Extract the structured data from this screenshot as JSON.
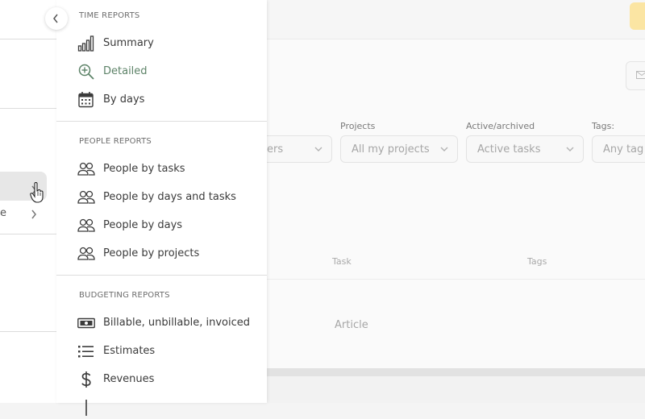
{
  "left_nav": {
    "visible_fragment": "e"
  },
  "filters": {
    "first": {
      "value_fragment": "ers"
    },
    "projects": {
      "label": "Projects",
      "value": "All my projects"
    },
    "active_archived": {
      "label": "Active/archived",
      "value": "Active tasks"
    },
    "tags": {
      "label": "Tags:",
      "placeholder": "Any tag"
    }
  },
  "table": {
    "headers": {
      "task": "Task",
      "tags": "Tags"
    },
    "rows": [
      {
        "task": "Article"
      }
    ]
  },
  "reports_menu": {
    "sections": [
      {
        "title": "TIME REPORTS",
        "items": [
          {
            "label": "Summary",
            "icon": "bar-chart-icon"
          },
          {
            "label": "Detailed",
            "icon": "zoom-in-icon"
          },
          {
            "label": "By days",
            "icon": "calendar-icon"
          }
        ]
      },
      {
        "title": "PEOPLE REPORTS",
        "items": [
          {
            "label": "People by tasks",
            "icon": "people-icon"
          },
          {
            "label": "People by days and tasks",
            "icon": "people-icon"
          },
          {
            "label": "People by days",
            "icon": "people-icon"
          },
          {
            "label": "People by projects",
            "icon": "people-icon"
          }
        ]
      },
      {
        "title": "BUDGETING REPORTS",
        "items": [
          {
            "label": "Billable, unbillable, invoiced",
            "icon": "banknote-icon"
          },
          {
            "label": "Estimates",
            "icon": "list-icon"
          },
          {
            "label": "Revenues",
            "icon": "dollar-icon"
          }
        ]
      }
    ]
  },
  "colors": {
    "accent_green": "#5c8267",
    "yellow_button": "#fbe5a3"
  }
}
